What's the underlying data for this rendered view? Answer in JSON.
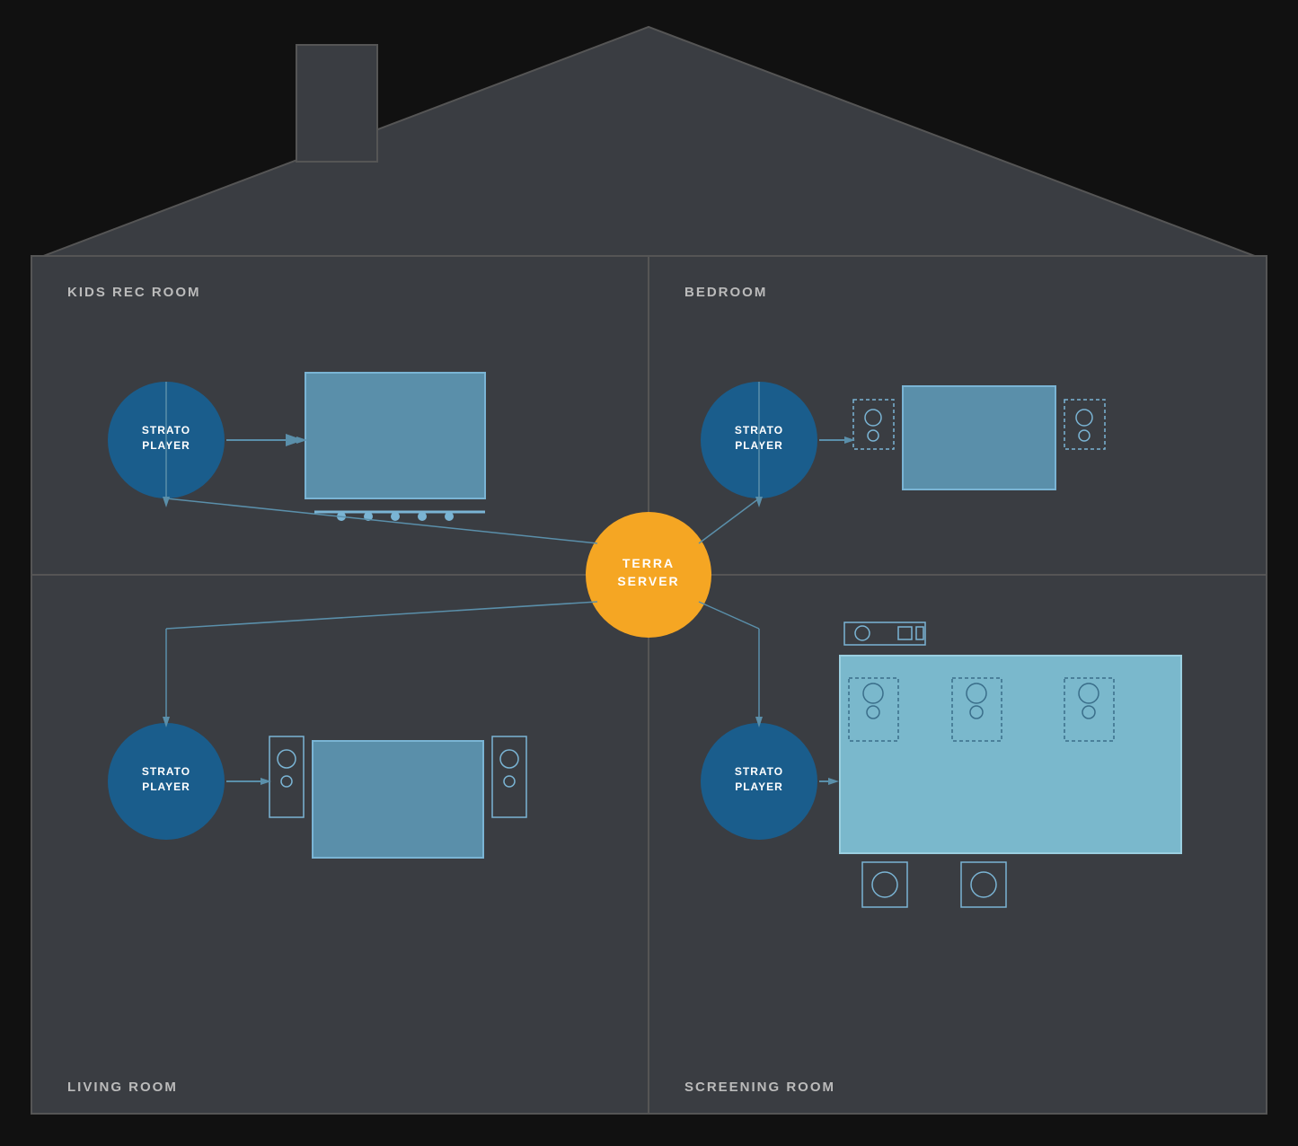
{
  "house": {
    "background_color": "#2c2e33",
    "border_color": "#555555",
    "roof_color": "#3a3d42"
  },
  "terra_server": {
    "label_line1": "TERRA",
    "label_line2": "SERVER",
    "color": "#f5a623"
  },
  "rooms": [
    {
      "id": "kids-rec-room",
      "title": "KIDS REC ROOM",
      "position": "top-left",
      "player_label_line1": "STRATO",
      "player_label_line2": "PLAYER"
    },
    {
      "id": "bedroom",
      "title": "BEDROOM",
      "position": "top-right",
      "player_label_line1": "STRATO",
      "player_label_line2": "PLAYER"
    },
    {
      "id": "living-room",
      "title": "LIVING ROOM",
      "position": "bottom-left",
      "player_label_line1": "STRATO",
      "player_label_line2": "PLAYER"
    },
    {
      "id": "screening-room",
      "title": "SCREENING ROOM",
      "position": "bottom-right",
      "player_label_line1": "STRATO",
      "player_label_line2": "PLAYER"
    }
  ]
}
